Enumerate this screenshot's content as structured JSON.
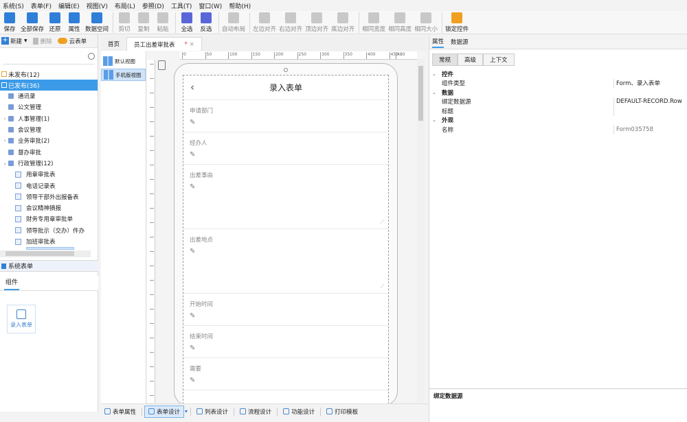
{
  "menu": [
    "系统(S)",
    "表单(F)",
    "编辑(E)",
    "视图(V)",
    "布局(L)",
    "参照(D)",
    "工具(T)",
    "窗口(W)",
    "帮助(H)"
  ],
  "toolbar": [
    {
      "label": "保存",
      "icon": "save-icon",
      "enabled": true,
      "color": "#2f7fd8"
    },
    {
      "label": "全部保存",
      "icon": "save-all-icon",
      "enabled": true,
      "color": "#2f7fd8"
    },
    {
      "label": "还原",
      "icon": "undo-icon",
      "enabled": true,
      "color": "#2f7fd8"
    },
    {
      "label": "属性",
      "icon": "info-icon",
      "enabled": true,
      "color": "#2f7fd8"
    },
    {
      "label": "数据空间",
      "icon": "map-icon",
      "enabled": true,
      "color": "#2f7fd8"
    },
    {
      "label": "剪切",
      "icon": "cut-icon",
      "enabled": false
    },
    {
      "label": "复制",
      "icon": "copy-icon",
      "enabled": false
    },
    {
      "label": "粘贴",
      "icon": "paste-icon",
      "enabled": false
    },
    {
      "label": "全选",
      "icon": "select-all-icon",
      "enabled": true,
      "color": "#5a66d8"
    },
    {
      "label": "反选",
      "icon": "invert-select-icon",
      "enabled": true,
      "color": "#5a66d8"
    },
    {
      "label": "自动布局",
      "icon": "auto-layout-icon",
      "enabled": false
    },
    {
      "label": "左边对齐",
      "icon": "align-left-icon",
      "enabled": false
    },
    {
      "label": "右边对齐",
      "icon": "align-right-icon",
      "enabled": false
    },
    {
      "label": "顶边对齐",
      "icon": "align-top-icon",
      "enabled": false
    },
    {
      "label": "底边对齐",
      "icon": "align-bottom-icon",
      "enabled": false
    },
    {
      "label": "相同宽度",
      "icon": "same-width-icon",
      "enabled": false
    },
    {
      "label": "相同高度",
      "icon": "same-height-icon",
      "enabled": false
    },
    {
      "label": "相同大小",
      "icon": "same-size-icon",
      "enabled": false
    },
    {
      "label": "锁定控件",
      "icon": "lock-icon",
      "enabled": true,
      "color": "#f0a020"
    }
  ],
  "left_panel": {
    "new_label": "新建",
    "delete_label": "删除",
    "cloud_label": "云表单",
    "unpublished": "未发布(12)",
    "published": "已发布(36)",
    "tree": [
      {
        "label": "通讯录",
        "type": "folder",
        "indent": 1
      },
      {
        "label": "公文管理",
        "type": "folder",
        "indent": 1
      },
      {
        "label": "人事管理(1)",
        "type": "folder",
        "indent": 1,
        "toggle": "›"
      },
      {
        "label": "会议管理",
        "type": "folder",
        "indent": 1
      },
      {
        "label": "业务审批(2)",
        "type": "folder",
        "indent": 1,
        "toggle": "›"
      },
      {
        "label": "督办审批",
        "type": "folder",
        "indent": 1
      },
      {
        "label": "行政管理(12)",
        "type": "folder",
        "indent": 1,
        "toggle": "⌄"
      },
      {
        "label": "用章审批表",
        "type": "doc",
        "indent": 2
      },
      {
        "label": "电话记录表",
        "type": "doc",
        "indent": 2
      },
      {
        "label": "领导干部外出报备表",
        "type": "doc",
        "indent": 2
      },
      {
        "label": "会议精神摘报",
        "type": "doc",
        "indent": 2
      },
      {
        "label": "财务专用章审批单",
        "type": "doc",
        "indent": 2
      },
      {
        "label": "领导批示（交办）件办",
        "type": "doc",
        "indent": 2
      },
      {
        "label": "加班审批表",
        "type": "doc",
        "indent": 2
      }
    ],
    "system_forms": "系统表单",
    "components_tab": "组件",
    "component_card": "录入表单"
  },
  "doc_tabs": [
    "首页",
    "员工出差审批表"
  ],
  "views": [
    "默认视图",
    "手机版视图"
  ],
  "form": {
    "title": "录入表单",
    "fields": [
      {
        "label": "申请部门",
        "multiline": false
      },
      {
        "label": "经办人",
        "multiline": false
      },
      {
        "label": "出差事由",
        "multiline": true
      },
      {
        "label": "出差地点",
        "multiline": true
      },
      {
        "label": "开始时间",
        "multiline": false
      },
      {
        "label": "结束时间",
        "multiline": false
      },
      {
        "label": "需要",
        "multiline": false
      }
    ]
  },
  "ruler_ticks": [
    "0",
    "50",
    "100",
    "150",
    "200",
    "250",
    "300",
    "350",
    "400",
    "450",
    "480"
  ],
  "bottom_tabs": [
    "表单属性",
    "表单设计",
    "列表设计",
    "流程设计",
    "功能设计",
    "打印模板"
  ],
  "right_panel": {
    "tabs": [
      "属性",
      "数据源"
    ],
    "subtabs": [
      "常规",
      "高级",
      "上下文"
    ],
    "categories": [
      {
        "name": "控件",
        "rows": [
          {
            "k": "组件类型",
            "v": "Form、录入表单"
          }
        ]
      },
      {
        "name": "数据",
        "rows": [
          {
            "k": "绑定数据源",
            "v": "DEFAULT-RECORD.Row"
          },
          {
            "k": "标题",
            "v": ""
          }
        ]
      },
      {
        "name": "外观",
        "rows": [
          {
            "k": "名称",
            "v": "Form035758"
          }
        ]
      }
    ],
    "description_title": "绑定数据源"
  }
}
